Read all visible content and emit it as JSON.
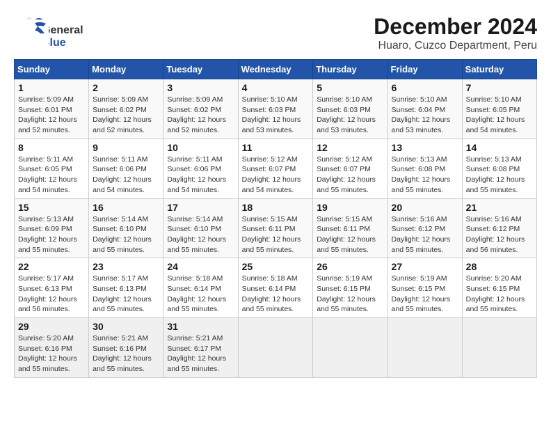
{
  "header": {
    "logo": {
      "general": "General",
      "blue": "Blue",
      "aria": "GeneralBlue logo"
    },
    "title": "December 2024",
    "subtitle": "Huaro, Cuzco Department, Peru"
  },
  "calendar": {
    "weekdays": [
      "Sunday",
      "Monday",
      "Tuesday",
      "Wednesday",
      "Thursday",
      "Friday",
      "Saturday"
    ],
    "weeks": [
      [
        {
          "day": "",
          "info": ""
        },
        {
          "day": "2",
          "info": "Sunrise: 5:09 AM\nSunset: 6:02 PM\nDaylight: 12 hours\nand 52 minutes."
        },
        {
          "day": "3",
          "info": "Sunrise: 5:09 AM\nSunset: 6:02 PM\nDaylight: 12 hours\nand 52 minutes."
        },
        {
          "day": "4",
          "info": "Sunrise: 5:10 AM\nSunset: 6:03 PM\nDaylight: 12 hours\nand 53 minutes."
        },
        {
          "day": "5",
          "info": "Sunrise: 5:10 AM\nSunset: 6:03 PM\nDaylight: 12 hours\nand 53 minutes."
        },
        {
          "day": "6",
          "info": "Sunrise: 5:10 AM\nSunset: 6:04 PM\nDaylight: 12 hours\nand 53 minutes."
        },
        {
          "day": "7",
          "info": "Sunrise: 5:10 AM\nSunset: 6:05 PM\nDaylight: 12 hours\nand 54 minutes."
        }
      ],
      [
        {
          "day": "8",
          "info": "Sunrise: 5:11 AM\nSunset: 6:05 PM\nDaylight: 12 hours\nand 54 minutes."
        },
        {
          "day": "9",
          "info": "Sunrise: 5:11 AM\nSunset: 6:06 PM\nDaylight: 12 hours\nand 54 minutes."
        },
        {
          "day": "10",
          "info": "Sunrise: 5:11 AM\nSunset: 6:06 PM\nDaylight: 12 hours\nand 54 minutes."
        },
        {
          "day": "11",
          "info": "Sunrise: 5:12 AM\nSunset: 6:07 PM\nDaylight: 12 hours\nand 54 minutes."
        },
        {
          "day": "12",
          "info": "Sunrise: 5:12 AM\nSunset: 6:07 PM\nDaylight: 12 hours\nand 55 minutes."
        },
        {
          "day": "13",
          "info": "Sunrise: 5:13 AM\nSunset: 6:08 PM\nDaylight: 12 hours\nand 55 minutes."
        },
        {
          "day": "14",
          "info": "Sunrise: 5:13 AM\nSunset: 6:08 PM\nDaylight: 12 hours\nand 55 minutes."
        }
      ],
      [
        {
          "day": "15",
          "info": "Sunrise: 5:13 AM\nSunset: 6:09 PM\nDaylight: 12 hours\nand 55 minutes."
        },
        {
          "day": "16",
          "info": "Sunrise: 5:14 AM\nSunset: 6:10 PM\nDaylight: 12 hours\nand 55 minutes."
        },
        {
          "day": "17",
          "info": "Sunrise: 5:14 AM\nSunset: 6:10 PM\nDaylight: 12 hours\nand 55 minutes."
        },
        {
          "day": "18",
          "info": "Sunrise: 5:15 AM\nSunset: 6:11 PM\nDaylight: 12 hours\nand 55 minutes."
        },
        {
          "day": "19",
          "info": "Sunrise: 5:15 AM\nSunset: 6:11 PM\nDaylight: 12 hours\nand 55 minutes."
        },
        {
          "day": "20",
          "info": "Sunrise: 5:16 AM\nSunset: 6:12 PM\nDaylight: 12 hours\nand 55 minutes."
        },
        {
          "day": "21",
          "info": "Sunrise: 5:16 AM\nSunset: 6:12 PM\nDaylight: 12 hours\nand 56 minutes."
        }
      ],
      [
        {
          "day": "22",
          "info": "Sunrise: 5:17 AM\nSunset: 6:13 PM\nDaylight: 12 hours\nand 56 minutes."
        },
        {
          "day": "23",
          "info": "Sunrise: 5:17 AM\nSunset: 6:13 PM\nDaylight: 12 hours\nand 55 minutes."
        },
        {
          "day": "24",
          "info": "Sunrise: 5:18 AM\nSunset: 6:14 PM\nDaylight: 12 hours\nand 55 minutes."
        },
        {
          "day": "25",
          "info": "Sunrise: 5:18 AM\nSunset: 6:14 PM\nDaylight: 12 hours\nand 55 minutes."
        },
        {
          "day": "26",
          "info": "Sunrise: 5:19 AM\nSunset: 6:15 PM\nDaylight: 12 hours\nand 55 minutes."
        },
        {
          "day": "27",
          "info": "Sunrise: 5:19 AM\nSunset: 6:15 PM\nDaylight: 12 hours\nand 55 minutes."
        },
        {
          "day": "28",
          "info": "Sunrise: 5:20 AM\nSunset: 6:15 PM\nDaylight: 12 hours\nand 55 minutes."
        }
      ],
      [
        {
          "day": "29",
          "info": "Sunrise: 5:20 AM\nSunset: 6:16 PM\nDaylight: 12 hours\nand 55 minutes."
        },
        {
          "day": "30",
          "info": "Sunrise: 5:21 AM\nSunset: 6:16 PM\nDaylight: 12 hours\nand 55 minutes."
        },
        {
          "day": "31",
          "info": "Sunrise: 5:21 AM\nSunset: 6:17 PM\nDaylight: 12 hours\nand 55 minutes."
        },
        {
          "day": "",
          "info": ""
        },
        {
          "day": "",
          "info": ""
        },
        {
          "day": "",
          "info": ""
        },
        {
          "day": "",
          "info": ""
        }
      ]
    ],
    "week1_day1": {
      "day": "1",
      "info": "Sunrise: 5:09 AM\nSunset: 6:01 PM\nDaylight: 12 hours\nand 52 minutes."
    }
  }
}
